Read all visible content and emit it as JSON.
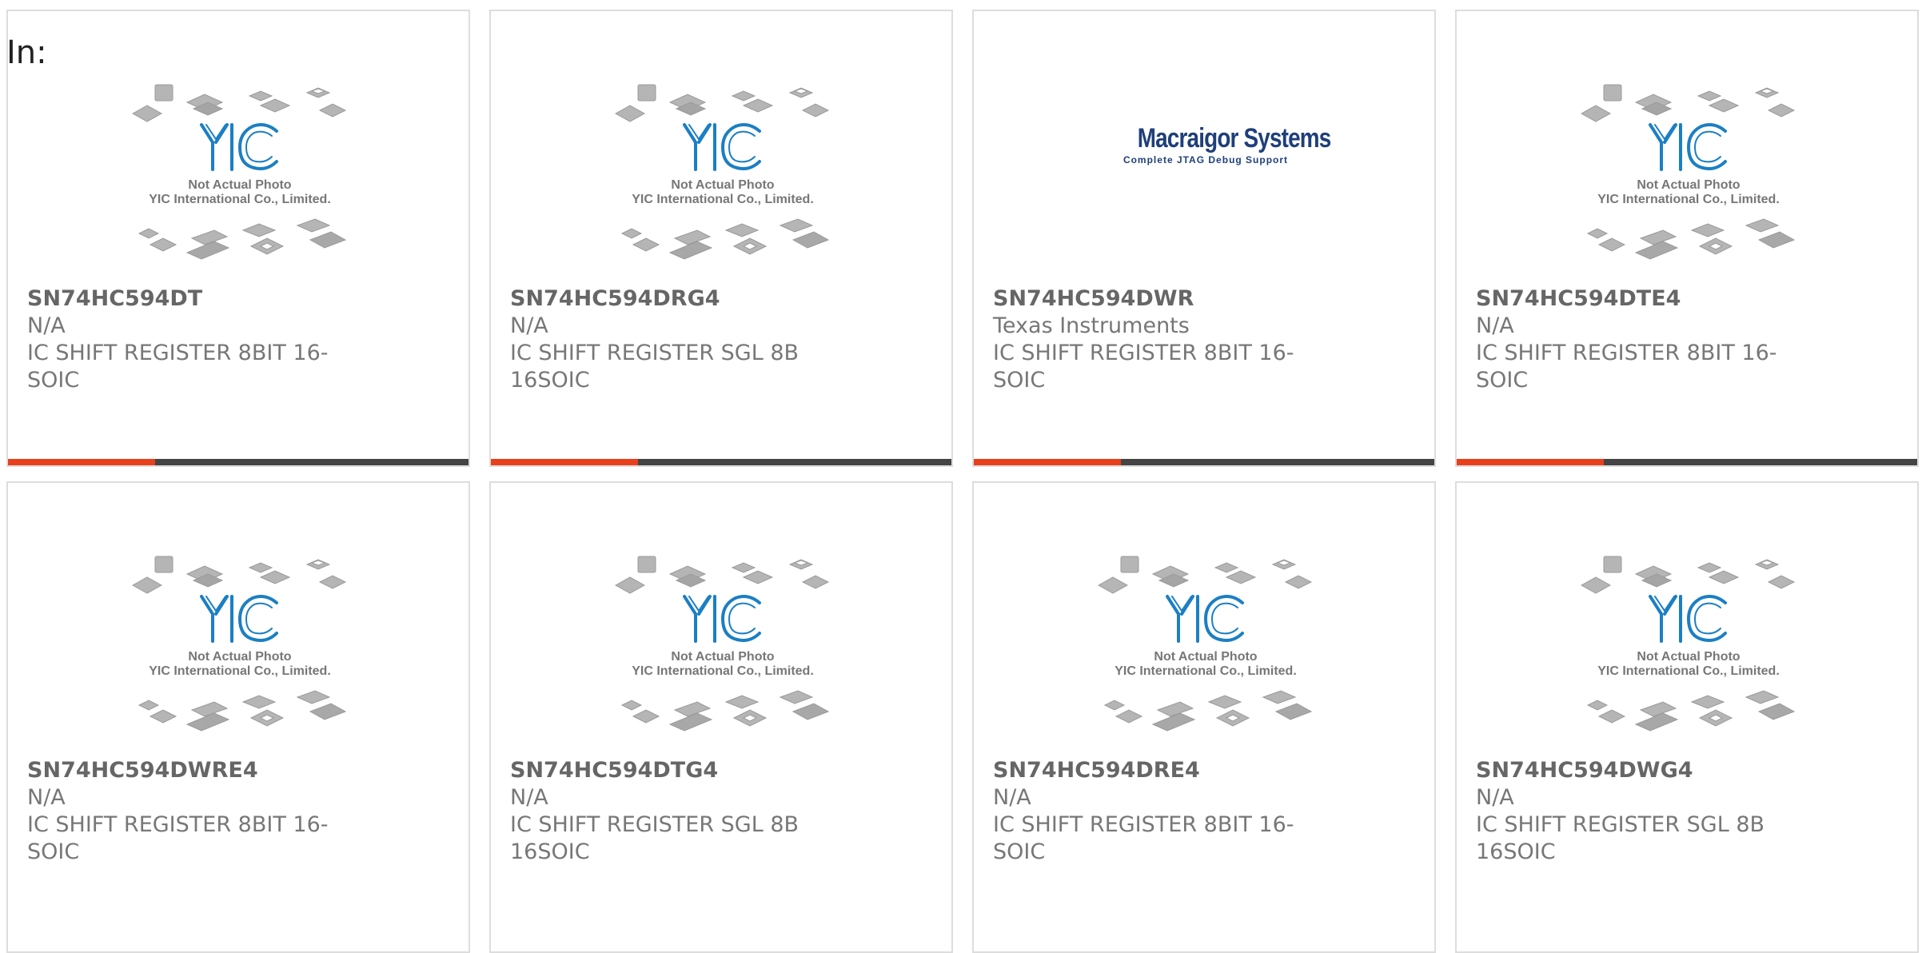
{
  "filter": {
    "label": "In:"
  },
  "colors": {
    "accent": "#e8401c",
    "bar": "#444444",
    "yic_blue": "#1b7fc4"
  },
  "placeholder_image": {
    "line1": "Not Actual Photo",
    "line2": "YIC International Co., Limited."
  },
  "logo_image": {
    "name": "Macraigor Systems",
    "tagline": "Complete JTAG Debug Support"
  },
  "products": [
    {
      "part_number": "SN74HC594DT",
      "manufacturer": "N/A",
      "description": "IC SHIFT REGISTER 8BIT 16-SOIC",
      "image": "placeholder",
      "progress": 0.32
    },
    {
      "part_number": "SN74HC594DRG4",
      "manufacturer": "N/A",
      "description": "IC SHIFT REGISTER SGL 8B 16SOIC",
      "image": "placeholder",
      "progress": 0.32
    },
    {
      "part_number": "SN74HC594DWR",
      "manufacturer": "Texas Instruments",
      "description": "IC SHIFT REGISTER 8BIT 16-SOIC",
      "image": "logo",
      "progress": 0.32
    },
    {
      "part_number": "SN74HC594DTE4",
      "manufacturer": "N/A",
      "description": "IC SHIFT REGISTER 8BIT 16-SOIC",
      "image": "placeholder",
      "progress": 0.32
    },
    {
      "part_number": "SN74HC594DWRE4",
      "manufacturer": "N/A",
      "description": "IC SHIFT REGISTER 8BIT 16-SOIC",
      "image": "placeholder"
    },
    {
      "part_number": "SN74HC594DTG4",
      "manufacturer": "N/A",
      "description": "IC SHIFT REGISTER SGL 8B 16SOIC",
      "image": "placeholder"
    },
    {
      "part_number": "SN74HC594DRE4",
      "manufacturer": "N/A",
      "description": "IC SHIFT REGISTER 8BIT 16-SOIC",
      "image": "placeholder"
    },
    {
      "part_number": "SN74HC594DWG4",
      "manufacturer": "N/A",
      "description": "IC SHIFT REGISTER SGL 8B 16SOIC",
      "image": "placeholder"
    }
  ]
}
